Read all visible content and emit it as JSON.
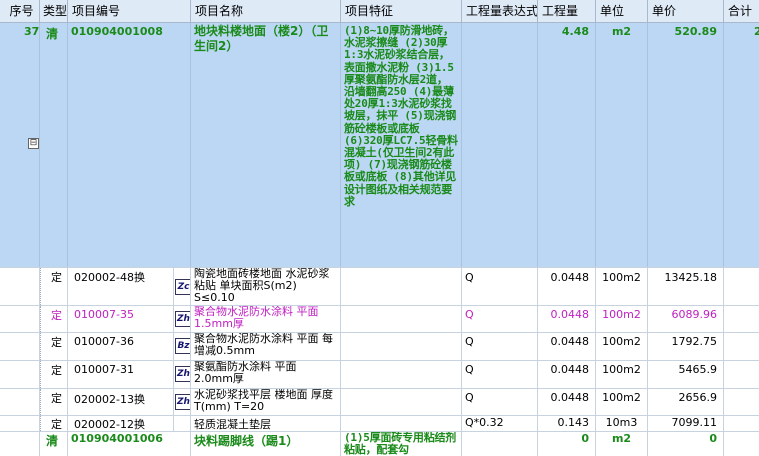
{
  "headers": {
    "seq": "序号",
    "type": "类型",
    "code": "项目编号",
    "name": "项目名称",
    "feature": "项目特征",
    "expr": "工程量表达式",
    "qty": "工程量",
    "unit": "单位",
    "price": "单价",
    "total": "合计"
  },
  "toggle_symbol": "⊟",
  "row1": {
    "seq": "37",
    "type": "清",
    "code": "010904001008",
    "name": "地块料楼地面（楼2）（卫生间2）",
    "feature": "(1)8~10厚防滑地砖，水泥浆擦缝 (2)30厚1:3水泥砂浆结合层，表面撒水泥粉 (3)1.5厚聚氨酯防水层2道，沿墙翻高250 (4)最薄处20厚1:3水泥砂浆找坡层，抹平 (5)现浇钢筋砼楼板或底板 (6)320厚LC7.5轻骨料混凝土(仅卫生间2有此项) (7)现浇钢筋砼楼板或底板 (8)其他详见设计图纸及相关规范要求",
    "qty": "4.48",
    "unit": "m2",
    "price": "520.89",
    "total": "2"
  },
  "sub_rows": [
    {
      "type": "定",
      "code": "020002-48换",
      "icon": "Zc",
      "name": "陶瓷地面砖楼地面 水泥砂浆粘贴 单块面积S(m2) S≤0.10",
      "expr": "Q",
      "qty": "0.0448",
      "unit": "100m2",
      "price": "13425.18"
    },
    {
      "type": "定",
      "code": "010007-35",
      "icon": "Zh",
      "name": "聚合物水泥防水涂料 平面 1.5mm厚",
      "expr": "Q",
      "qty": "0.0448",
      "unit": "100m2",
      "price": "6089.96"
    },
    {
      "type": "定",
      "code": "010007-36",
      "icon": "Bz",
      "name": "聚合物水泥防水涂料 平面 每增减0.5mm",
      "expr": "Q",
      "qty": "0.0448",
      "unit": "100m2",
      "price": "1792.75"
    },
    {
      "type": "定",
      "code": "010007-31",
      "icon": "Zh",
      "name": "聚氨酯防水涂料 平面 2.0mm厚",
      "expr": "Q",
      "qty": "0.0448",
      "unit": "100m2",
      "price": "5465.9"
    },
    {
      "type": "定",
      "code": "020002-13换",
      "icon": "Zh",
      "name": "水泥砂浆找平层 楼地面 厚度T(mm) T=20",
      "expr": "Q",
      "qty": "0.0448",
      "unit": "100m2",
      "price": "2656.9"
    },
    {
      "type": "定",
      "code": "020002-12换",
      "icon": "",
      "name": "轻质混凝土垫层",
      "expr": "Q*0.32",
      "qty": "0.143",
      "unit": "10m3",
      "price": "7099.11"
    }
  ],
  "row_last": {
    "type": "清",
    "code": "010904001006",
    "name": "块料踢脚线（踢1）",
    "feature": "(1)5厚面砖专用粘结剂粘贴，配套勾",
    "qty": "0",
    "unit": "m2",
    "price": "0"
  }
}
